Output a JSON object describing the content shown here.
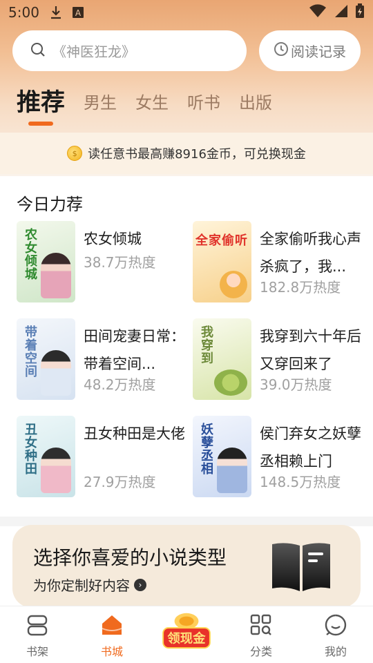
{
  "status_bar": {
    "time": "5:00"
  },
  "search": {
    "placeholder": "《神医狂龙》"
  },
  "history_button": {
    "label": "阅读记录"
  },
  "tabs": [
    {
      "label": "推荐",
      "active": true
    },
    {
      "label": "男生"
    },
    {
      "label": "女生"
    },
    {
      "label": "听书"
    },
    {
      "label": "出版"
    }
  ],
  "coin_banner": {
    "text": "读任意书最高赚8916金币，可兑换现金"
  },
  "section": {
    "title": "今日力荐"
  },
  "books": [
    {
      "title": "农女倾城",
      "heat": "38.7万热度",
      "cover_text": "农女倾城",
      "cover_color": "#e8f3e0",
      "accent": "#2f8a2f"
    },
    {
      "title": "全家偷听我心声杀疯了，我...",
      "heat": "182.8万热度",
      "cover_text": "全家偷听",
      "cover_color": "#fdf0d6",
      "accent": "#e0322a"
    },
    {
      "title": "田间宠妻日常：带着空间...",
      "heat": "48.2万热度",
      "cover_text": "带着空间",
      "cover_color": "#eef3fa",
      "accent": "#5a7fb5"
    },
    {
      "title": "我穿到六十年后又穿回来了",
      "heat": "39.0万热度",
      "cover_text": "我穿到",
      "cover_color": "#f4f6e6",
      "accent": "#6d8a3a"
    },
    {
      "title": "丑女种田是大佬",
      "heat": "27.9万热度",
      "cover_text": "丑女种田",
      "cover_color": "#e6f2f4",
      "accent": "#2e6e86"
    },
    {
      "title": "侯门弃女之妖孽丞相赖上门",
      "heat": "148.5万热度",
      "cover_text": "妖孽丞相",
      "cover_color": "#eaf0fb",
      "accent": "#2a4f9a"
    }
  ],
  "genre_card": {
    "title": "选择你喜爱的小说类型",
    "subtitle": "为你定制好内容"
  },
  "bottom_nav": [
    {
      "label": "书架"
    },
    {
      "label": "书城",
      "active": true
    },
    {
      "label": "领现金"
    },
    {
      "label": "分类"
    },
    {
      "label": "我的"
    }
  ],
  "colors": {
    "accent": "#f06a1e"
  }
}
